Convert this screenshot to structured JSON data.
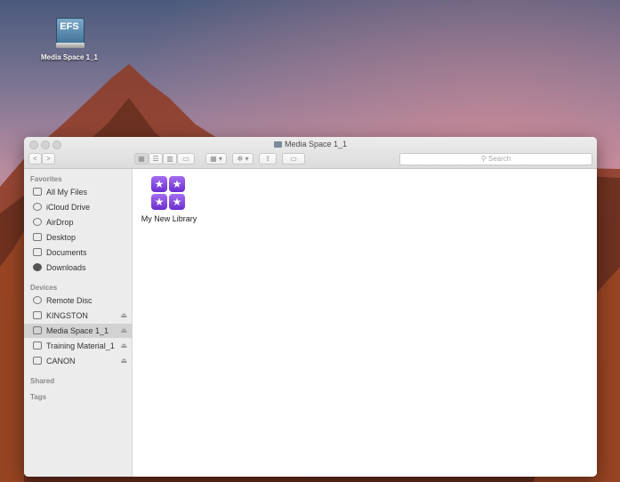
{
  "desktop": {
    "drive_label": "EFS",
    "drive_name": "Media Space 1_1"
  },
  "window": {
    "title": "Media Space 1_1",
    "search_placeholder": "Search",
    "nav_back": "<",
    "nav_forward": ">",
    "view_icon": "icon-view-icon",
    "view_list": "list-view-icon",
    "view_columns": "column-view-icon",
    "view_coverflow": "coverflow-view-icon",
    "arrange_icon": "arrange-icon",
    "action_icon": "gear-icon",
    "share_icon": "share-icon",
    "tag_icon": "tag-icon"
  },
  "sidebar": {
    "favorites_heading": "Favorites",
    "favorites": [
      {
        "label": "All My Files",
        "icon": "all-files-icon"
      },
      {
        "label": "iCloud Drive",
        "icon": "cloud-icon"
      },
      {
        "label": "AirDrop",
        "icon": "airdrop-icon"
      },
      {
        "label": "Desktop",
        "icon": "desktop-icon"
      },
      {
        "label": "Documents",
        "icon": "documents-icon"
      },
      {
        "label": "Downloads",
        "icon": "downloads-icon"
      }
    ],
    "devices_heading": "Devices",
    "devices": [
      {
        "label": "Remote Disc",
        "icon": "disc-icon",
        "eject": false
      },
      {
        "label": "KINGSTON",
        "icon": "drive-icon",
        "eject": true
      },
      {
        "label": "Media Space 1_1",
        "icon": "drive-icon",
        "eject": true,
        "selected": true
      },
      {
        "label": "Training Material_1",
        "icon": "drive-icon",
        "eject": true
      },
      {
        "label": "CANON",
        "icon": "drive-icon",
        "eject": true
      }
    ],
    "shared_heading": "Shared",
    "tags_heading": "Tags"
  },
  "content": {
    "items": [
      {
        "name": "My New Library",
        "icon": "library-icon"
      }
    ]
  }
}
